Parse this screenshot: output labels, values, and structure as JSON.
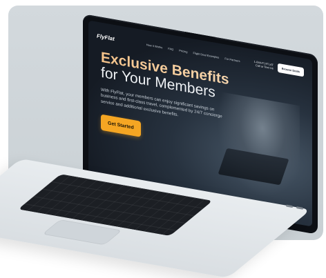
{
  "site": {
    "logo": "FlyFlat",
    "nav": [
      "How it Works",
      "FAQ",
      "Pricing",
      "Flight Deal Examples",
      "For Partners"
    ],
    "phone_line1": "1-844-FLYFLAT",
    "phone_line2": "Call or Text Us",
    "nav_button": "Browse Deals",
    "headline_line1": "Exclusive Benefits",
    "headline_line2": "for Your Members",
    "description": "With FlyFlat, your members can enjoy significant savings on business and first-class travel, complemented by 24/7 concierge service and additional exclusive benefits.",
    "cta": "Get Started"
  },
  "colors": {
    "accent_orange": "#f5a623",
    "headline_gradient_start": "#f5c38a",
    "headline_gradient_end": "#f6d7b0",
    "background": "#c9d0d4"
  }
}
